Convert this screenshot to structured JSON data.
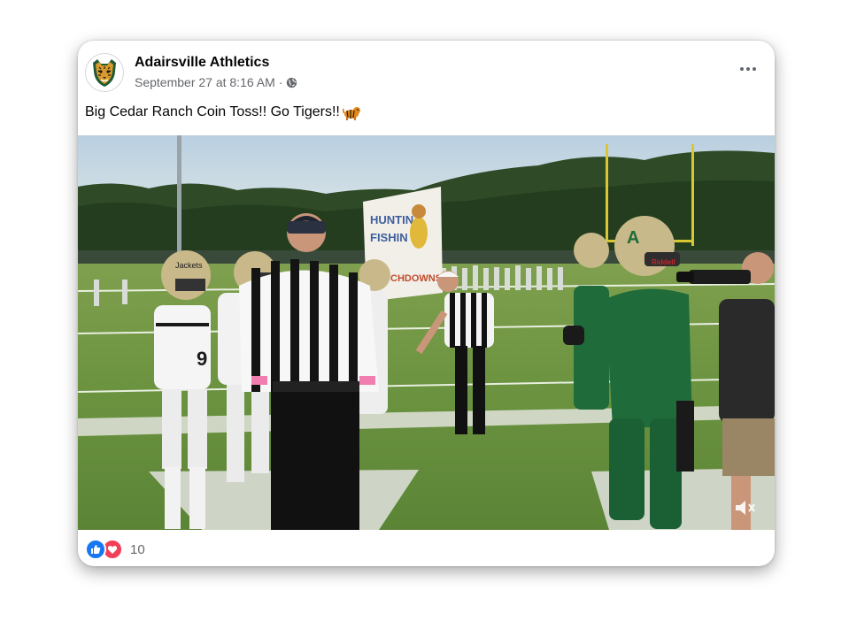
{
  "post": {
    "page_name": "Adairsville Athletics",
    "timestamp": "September 27 at 8:16 AM",
    "separator": "·",
    "privacy_icon": "globe-icon",
    "avatar_icon": "tiger-logo-icon",
    "more_icon": "more-options-icon",
    "caption": "Big Cedar Ranch Coin Toss!! Go Tigers!!",
    "caption_emoji": "tiger-emoji-icon",
    "media": {
      "type": "video",
      "description_icon": "football-coin-toss-video",
      "banner_text_1": "HUNTIN",
      "banner_text_2": "FISHIN",
      "banner_text_3": "TOUCHDOWNS",
      "helmet_letter": "A",
      "helmet_brand": "Riddell",
      "jersey_number": "9",
      "helmet_text": "Jackets",
      "volume_icon": "muted-volume-icon"
    },
    "reactions": {
      "icons": [
        "like-icon",
        "love-icon"
      ],
      "count": "10"
    }
  },
  "colors": {
    "like": "#1877f2",
    "love": "#f33e58",
    "text_primary": "#050505",
    "text_secondary": "#65676b",
    "home_green": "#1f6b3a"
  }
}
